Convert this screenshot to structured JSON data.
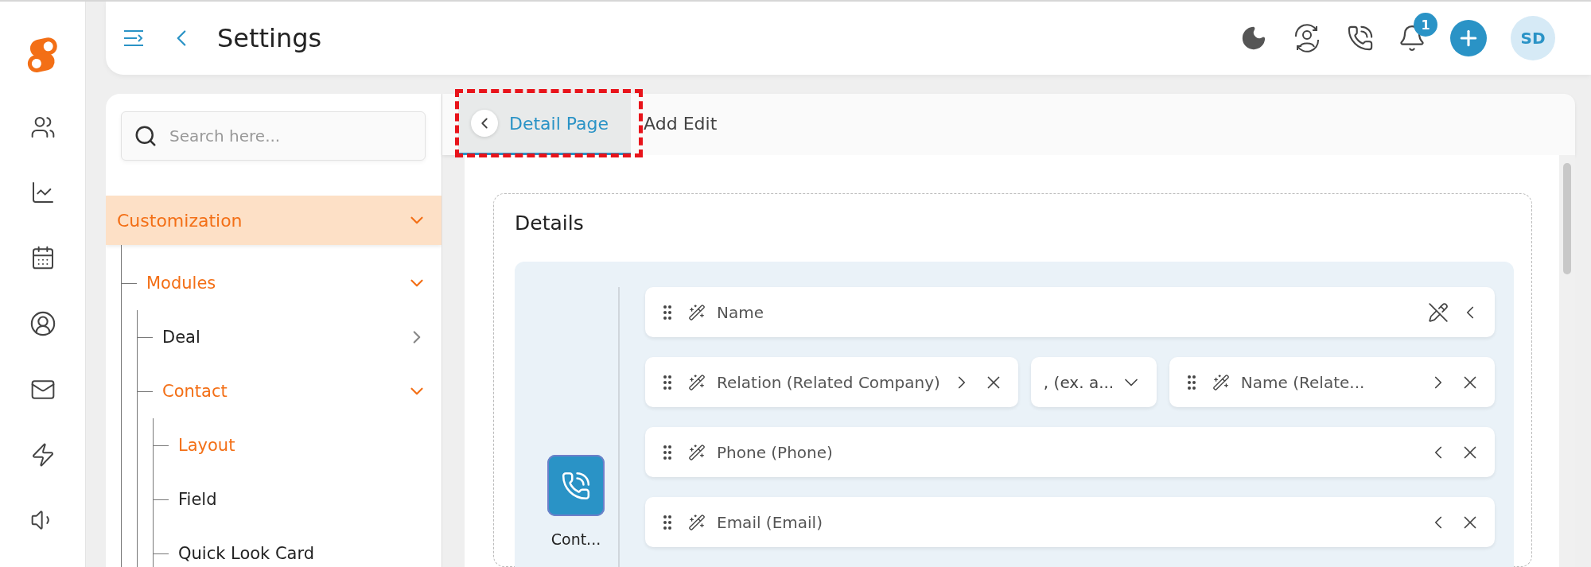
{
  "header": {
    "title": "Settings",
    "notification_count": "1",
    "avatar_initials": "SD"
  },
  "sidebar": {
    "search": {
      "placeholder": "Search here..."
    },
    "tree": [
      {
        "label": "Customization",
        "expanded": true,
        "selected": true,
        "children": [
          {
            "label": "Modules",
            "expanded": true,
            "selected": true,
            "children": [
              {
                "label": "Deal",
                "expanded": false,
                "selected": false
              },
              {
                "label": "Contact",
                "expanded": true,
                "selected": true,
                "children": [
                  {
                    "label": "Layout",
                    "selected": true
                  },
                  {
                    "label": "Field",
                    "selected": false
                  },
                  {
                    "label": "Quick Look Card",
                    "selected": false
                  }
                ]
              }
            ]
          }
        ]
      }
    ]
  },
  "tabs": [
    {
      "label": "Detail Page",
      "selected": true
    },
    {
      "label": "Add Edit",
      "selected": false
    }
  ],
  "details": {
    "title": "Details",
    "section": {
      "label": "Cont..."
    },
    "rows": [
      [
        {
          "kind": "field",
          "label": "Name",
          "actions": [
            {
              "kind": "edit-off"
            },
            {
              "kind": "collapse"
            }
          ]
        }
      ],
      [
        {
          "kind": "field",
          "label": "Relation (Related Company)",
          "actions": [
            {
              "kind": "expand"
            },
            {
              "kind": "remove"
            }
          ]
        },
        {
          "kind": "select",
          "value": ", (ex. a..."
        },
        {
          "kind": "field",
          "label": "Name (Relate...",
          "actions": [
            {
              "kind": "expand"
            },
            {
              "kind": "remove"
            }
          ]
        }
      ],
      [
        {
          "kind": "field",
          "label": "Phone (Phone)",
          "actions": [
            {
              "kind": "collapse"
            },
            {
              "kind": "remove"
            }
          ]
        }
      ],
      [
        {
          "kind": "field",
          "label": "Email (Email)",
          "actions": [
            {
              "kind": "collapse"
            },
            {
              "kind": "remove"
            }
          ]
        }
      ]
    ]
  }
}
